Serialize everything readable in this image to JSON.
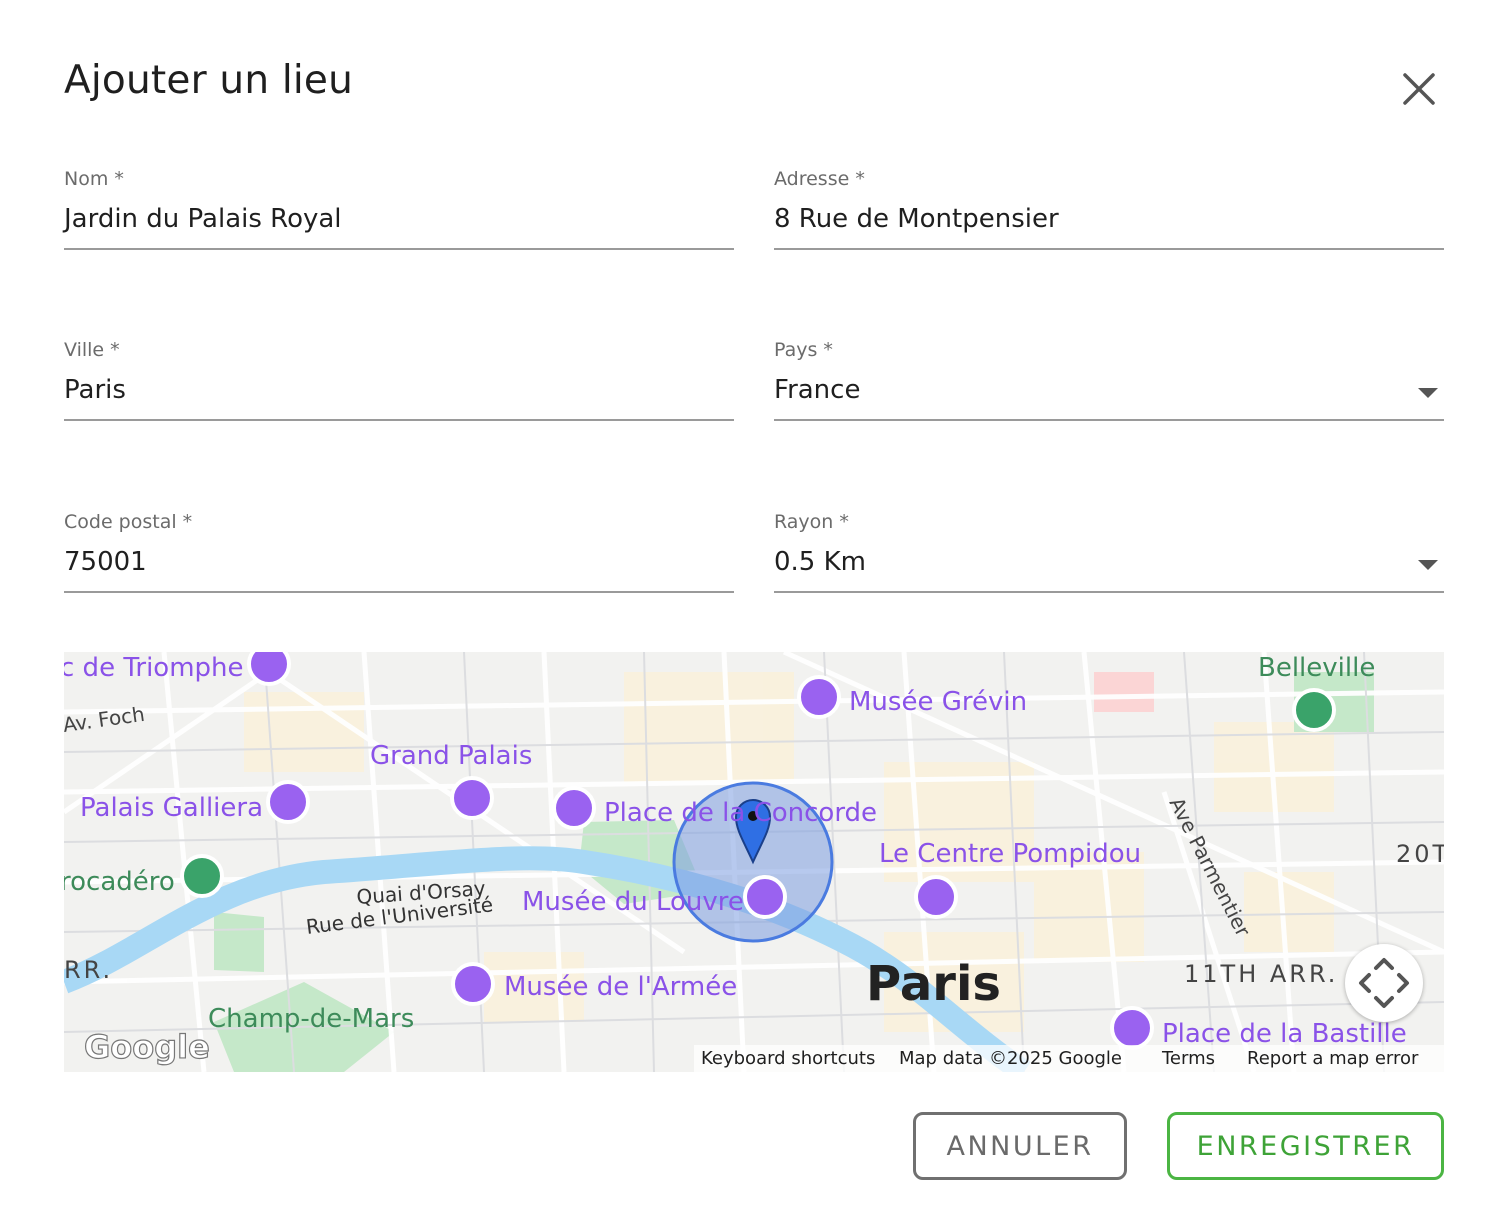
{
  "dialog": {
    "title": "Ajouter un lieu"
  },
  "form": {
    "name": {
      "label": "Nom *",
      "value": "Jardin du Palais Royal"
    },
    "address": {
      "label": "Adresse *",
      "value": "8 Rue de Montpensier"
    },
    "city": {
      "label": "Ville *",
      "value": "Paris"
    },
    "country": {
      "label": "Pays *",
      "value": "France"
    },
    "postal_code": {
      "label": "Code postal *",
      "value": "75001"
    },
    "radius": {
      "label": "Rayon *",
      "value": "0.5 Km"
    }
  },
  "map": {
    "labels": {
      "arc": "c de Triomphe",
      "foch": "Av. Foch",
      "grevin": "Musée Grévin",
      "belleville": "Belleville",
      "grand_palais": "Grand Palais",
      "galliera": "Palais Galliera",
      "concorde": "Place de la Concorde",
      "pompidou": "Le Centre Pompidou",
      "parmentier": "Ave Parmentier",
      "arr20": "20T",
      "trocadero": "rocadéro",
      "quai_orsay": "Quai d'Orsay",
      "rue_universite": "Rue de l'Université",
      "louvre": "Musée du Louvre",
      "arr_left": "RR.",
      "armee": "Musée de l'Armée",
      "paris": "Paris",
      "arr11": "11TH ARR.",
      "champ_de_mars": "Champ-de-Mars",
      "bastille": "Place de la Bastille",
      "google": "Google"
    },
    "attribution": {
      "shortcuts": "Keyboard shortcuts",
      "data": "Map data ©2025 Google",
      "terms": "Terms",
      "report": "Report a map error"
    },
    "colors": {
      "water": "#aadaff",
      "park": "#c3e7c7",
      "poi": "#9a62f0",
      "radius_fill": "#7b9de0",
      "radius_stroke": "#4a7be0"
    }
  },
  "actions": {
    "cancel": "ANNULER",
    "save": "ENREGISTRER"
  }
}
